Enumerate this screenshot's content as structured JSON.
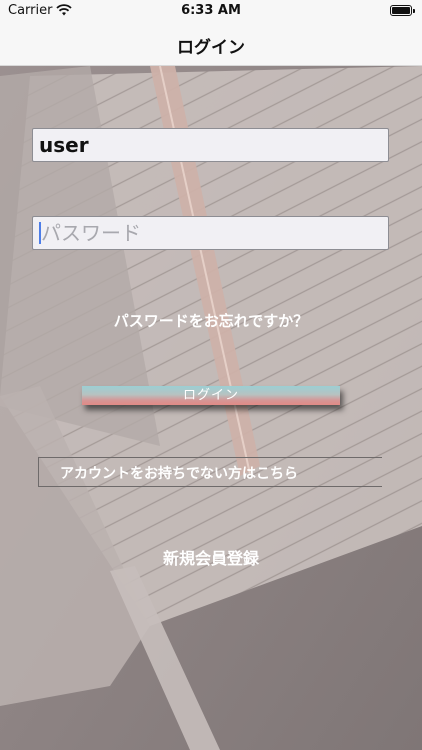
{
  "status_bar": {
    "carrier": "Carrier",
    "time": "6:33 AM"
  },
  "nav": {
    "title": "ログイン"
  },
  "form": {
    "username_value": "user",
    "password_placeholder": "パスワード",
    "forgot_password_label": "パスワードをお忘れですか？",
    "login_button_label": "ログイン",
    "no_account_label": "アカウントをお持ちでない方はこちら",
    "register_label": "新規会員登録"
  },
  "colors": {
    "nav_background": "#f7f7f7",
    "field_background": "#f1f0f4",
    "button_top": "#9ccfd3",
    "button_bottom": "#e28a86",
    "caret": "#4d7de8",
    "text_on_background": "#ffffff"
  },
  "icons": [
    "wifi-icon",
    "battery-icon"
  ]
}
